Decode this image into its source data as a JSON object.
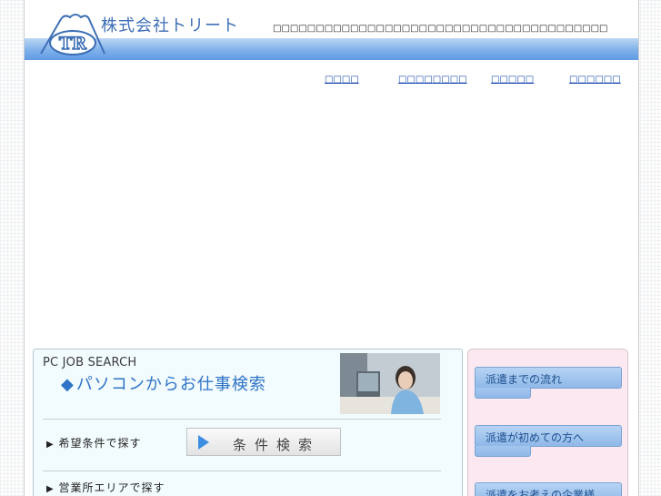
{
  "header": {
    "company_name": "株式会社トリート",
    "tagline": "□□□□□□□□□□□□□□□□□□□□□□□□□□□□□□□□□□□□□□□",
    "logo_text": "TR"
  },
  "nav": {
    "items": [
      {
        "label": "□□□□"
      },
      {
        "label": "□□□□□□□□"
      },
      {
        "label": "□□□□□"
      },
      {
        "label": "□□□□□□"
      }
    ]
  },
  "job_search": {
    "title": "PC JOB SEARCH",
    "subtitle_icon": "◆",
    "subtitle": "パソコンからお仕事検索",
    "condition_label": "希望条件で探す",
    "condition_button": "条件検索",
    "area_label": "営業所エリアで探す",
    "arrow_glyph": "▶"
  },
  "side_menu": {
    "items": [
      {
        "label": "派遣までの流れ"
      },
      {
        "label": "派遣が初めての方へ"
      },
      {
        "label": "派遣をお考えの企業様"
      }
    ]
  },
  "colors": {
    "brand_blue": "#3d6fb6",
    "link_blue": "#1f4fb2",
    "band_blue": "#7fb0ea",
    "side_panel_pink": "#fbe8f0",
    "search_panel_bg": "#f2fbfd"
  }
}
